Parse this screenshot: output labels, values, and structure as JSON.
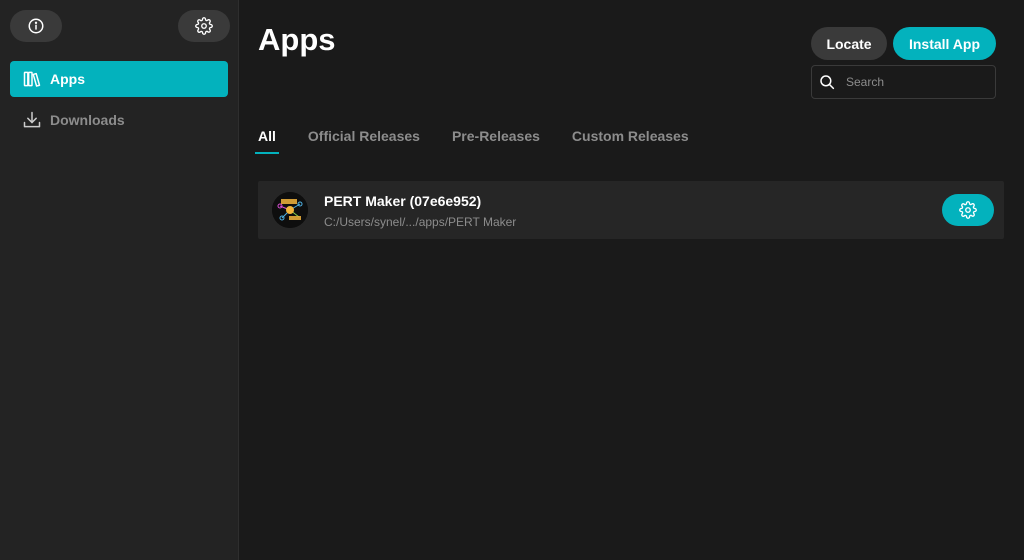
{
  "sidebar": {
    "top_buttons": [
      {
        "name": "info",
        "icon": "info-icon"
      },
      {
        "name": "settings",
        "icon": "gear-icon"
      }
    ],
    "items": [
      {
        "label": "Apps",
        "icon": "books-icon",
        "active": true
      },
      {
        "label": "Downloads",
        "icon": "download-icon",
        "active": false
      }
    ]
  },
  "header": {
    "title": "Apps",
    "locate_label": "Locate",
    "install_label": "Install App"
  },
  "search": {
    "placeholder": "Search",
    "value": ""
  },
  "tabs": [
    {
      "label": "All",
      "active": true
    },
    {
      "label": "Official Releases",
      "active": false
    },
    {
      "label": "Pre-Releases",
      "active": false
    },
    {
      "label": "Custom Releases",
      "active": false
    }
  ],
  "apps": [
    {
      "name": "PERT Maker (07e6e952)",
      "path": "C:/Users/synel/.../apps/PERT Maker",
      "icon": "pert-maker-logo"
    }
  ],
  "colors": {
    "accent": "#03b2bd",
    "background": "#1a1a1a",
    "sidebar": "#232323",
    "muted_text": "#8c8c8c",
    "button_gray": "#3a3a3a"
  }
}
